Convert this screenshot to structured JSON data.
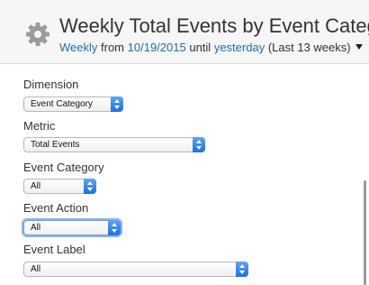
{
  "header": {
    "title": "Weekly Total Events by Event Catego",
    "icon": "gear-icon",
    "period_label": "Weekly",
    "from_text": "from",
    "start_date": "10/19/2015",
    "until_text": "until",
    "end_label": "yesterday",
    "range_note": "(Last 13 weeks)"
  },
  "fields": [
    {
      "label": "Dimension",
      "value": "Event Category"
    },
    {
      "label": "Metric",
      "value": "Total Events"
    },
    {
      "label": "Event Category",
      "value": "All"
    },
    {
      "label": "Event Action",
      "value": "All"
    },
    {
      "label": "Event Label",
      "value": "All"
    }
  ],
  "colors": {
    "link": "#1f6fb8",
    "select_button": "#2a7ae2",
    "focus_ring": "#8ab4ee"
  }
}
